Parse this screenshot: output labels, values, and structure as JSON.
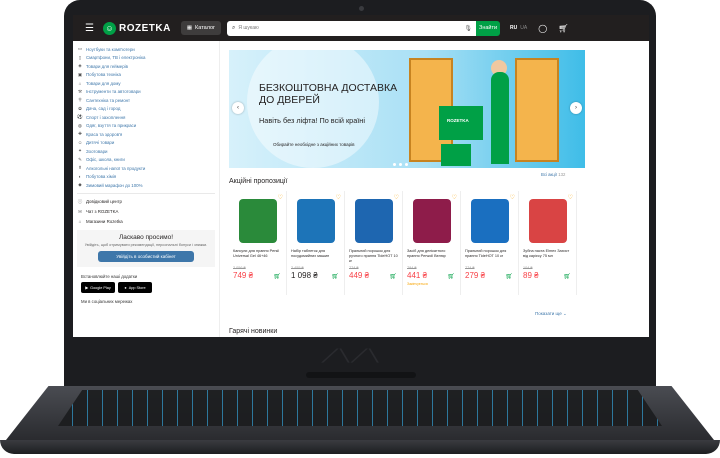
{
  "header": {
    "logo_text": "ROZETKA",
    "catalog_label": "Каталог",
    "search_placeholder": "Я шукаю",
    "search_button": "Знайти",
    "lang_active": "RU",
    "lang_other": "UA"
  },
  "sidebar": {
    "categories": [
      "Ноутбуки та комп'ютери",
      "Смартфони, ТВ і електроніка",
      "Товари для геймерів",
      "Побутова техніка",
      "Товари для дому",
      "Інструменти та автотовари",
      "Сантехніка та ремонт",
      "Дача, сад і город",
      "Спорт і захоплення",
      "Одяг, взуття та прикраси",
      "Краса та здоров'я",
      "Дитячі товари",
      "Зоотовари",
      "Офіс, школа, книги",
      "Алкогольні напої та продукти",
      "Побутова хімія",
      "Зимовий марафон до 100%"
    ],
    "extra_links": [
      "Довідковий центр",
      "Чат з ROZETKA",
      "Магазини Rozetka"
    ],
    "welcome_title": "Ласкаво просимо!",
    "welcome_text": "Увійдіть, щоб отримувати рекомендації, персональні бонуси і знижки.",
    "welcome_button": "Увійдіть в особистий кабінет",
    "apps_title": "Встановлюйте наші додатки",
    "store_google": "Google Play",
    "store_apple": "App Store",
    "social_title": "Ми в соціальних мережах"
  },
  "banner": {
    "title": "БЕЗКОШТОВНА ДОСТАВКА ДО ДВЕРЕЙ",
    "subtitle": "Навіть без ліфта! По всій країні",
    "note": "Обирайте необхідне з акційних товарів",
    "box_label": "ROZETKA"
  },
  "all_ads": "Всі акції",
  "all_ads_count": "132",
  "sections": {
    "promo_title": "Акційні пропозиції",
    "hot_title": "Гарячі новинки",
    "show_more": "Показати ще"
  },
  "products": [
    {
      "name": "Капсули для прання Persil Universal Gel 46+46",
      "old": "2 056 ₴",
      "price": "749 ₴",
      "color": "#2a8a3a",
      "note": ""
    },
    {
      "name": "Набір таблеток для посудомийних машин",
      "old": "2 455 ₴",
      "price": "1 098 ₴",
      "color": "#1d74b8",
      "note": ""
    },
    {
      "name": "Пральний порошок для ручного прання TideHOT 10 кг",
      "old": "774 ₴",
      "price": "449 ₴",
      "color": "#1e66b0",
      "note": ""
    },
    {
      "name": "Засіб для делікатного прання Perwoll Велюр",
      "old": "784 ₴",
      "price": "441 ₴",
      "color": "#8e1c4a",
      "note": "Закінчується"
    },
    {
      "name": "Пральний порошок для прання TideHOT 10 кг",
      "old": "774 ₴",
      "price": "279 ₴",
      "color": "#1a6fc0",
      "note": ""
    },
    {
      "name": "Зубна паста Elmex Захист від карієсу 75 мл",
      "old": "104 ₴",
      "price": "89 ₴",
      "color": "#d94444",
      "note": ""
    }
  ]
}
